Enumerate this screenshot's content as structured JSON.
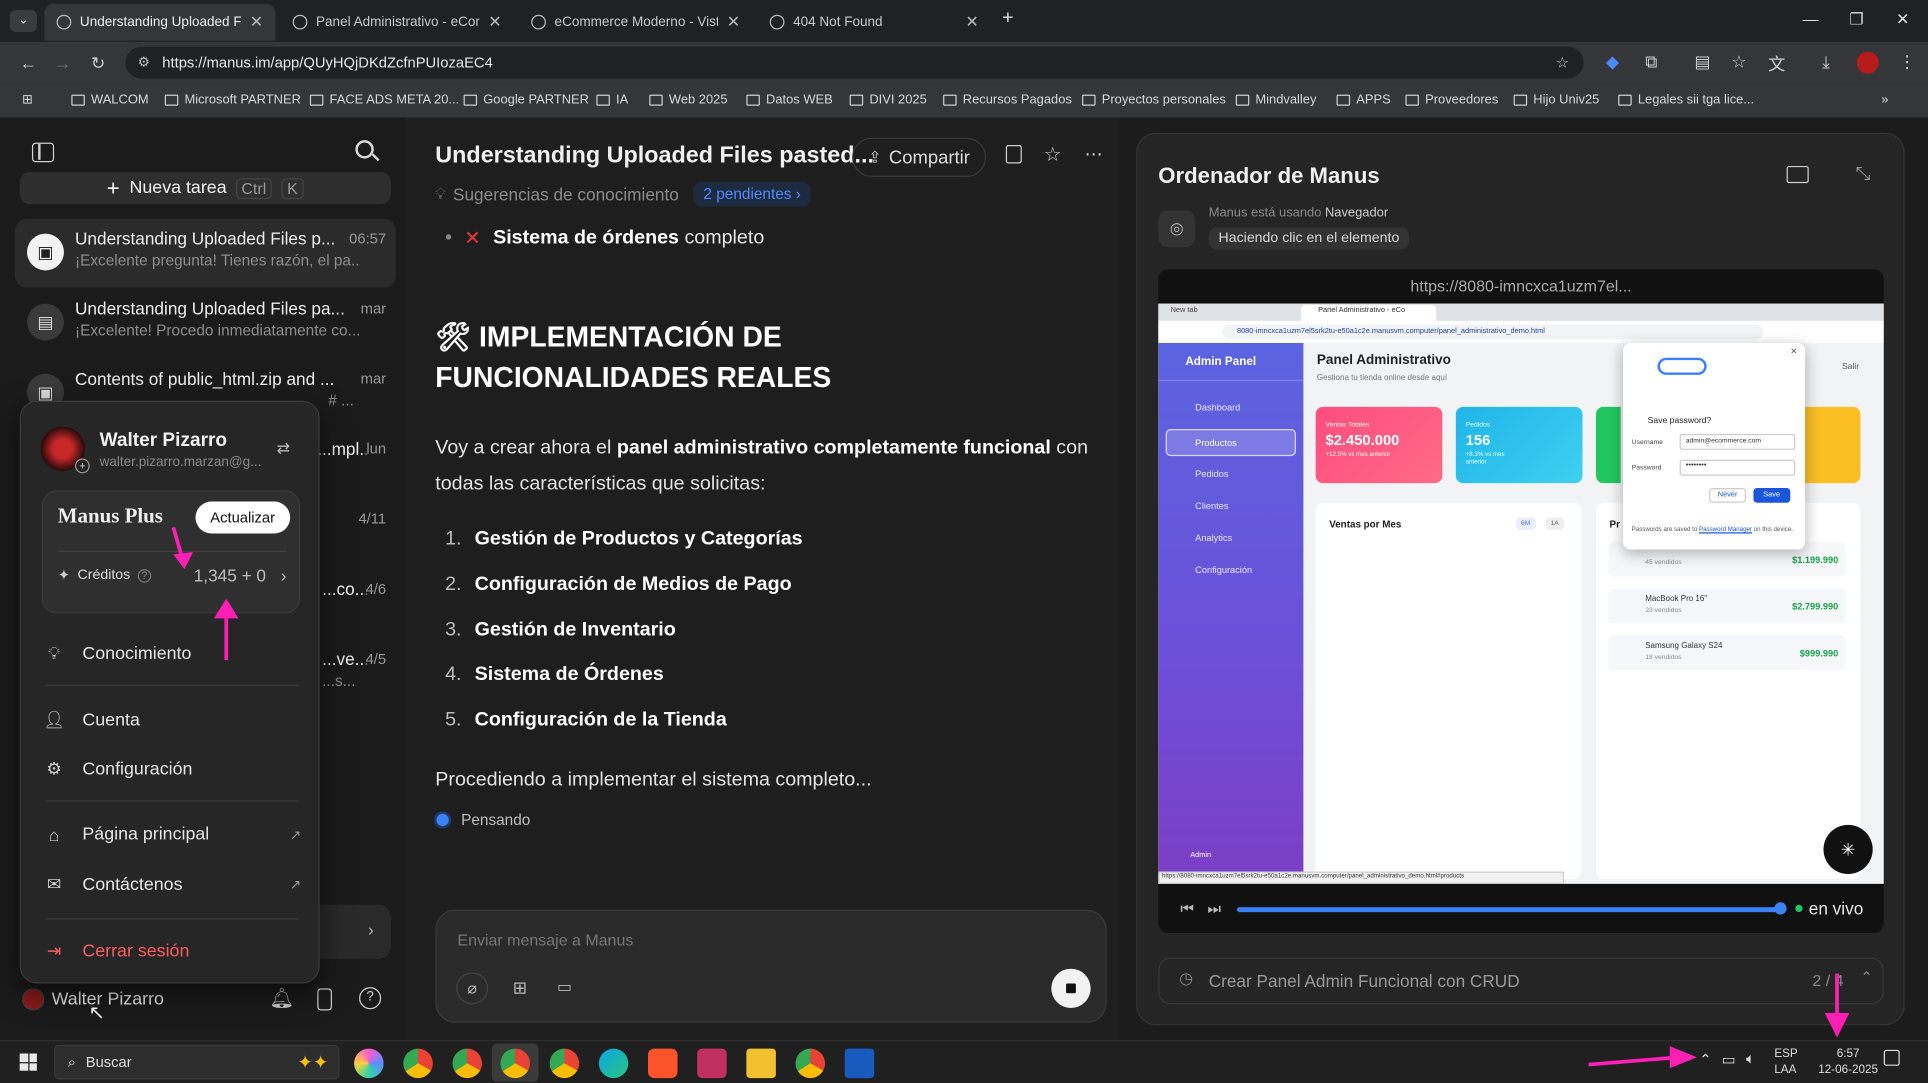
{
  "browser": {
    "tabs": [
      {
        "title": "Understanding Uploaded Files p"
      },
      {
        "title": "Panel Administrativo - eComm"
      },
      {
        "title": "eCommerce Moderno - Vista P"
      },
      {
        "title": "404 Not Found"
      }
    ],
    "new_tab": "+",
    "url": "https://manus.im/app/QUyHQjDKdZcfnPUIozaEC4",
    "bookmarks": [
      "WALCOM",
      "Microsoft PARTNER",
      "FACE ADS META 20...",
      "Google PARTNER",
      "IA",
      "Web 2025",
      "Datos WEB",
      "DIVI 2025",
      "Recursos Pagados",
      "Proyectos personales",
      "Mindvalley",
      "APPS",
      "Proveedores",
      "Hijo Univ25",
      "Legales sii tga lice..."
    ]
  },
  "sidebar": {
    "new_task": "Nueva tarea",
    "shortcut_keys": [
      "Ctrl",
      "K"
    ],
    "tasks": [
      {
        "title": "Understanding Uploaded Files p...",
        "snippet": "¡Excelente pregunta! Tienes razón, el pa...",
        "date": "06:57"
      },
      {
        "title": "Understanding Uploaded Files pa...",
        "snippet": "¡Excelente! Procedo inmediatamente co...",
        "date": "mar"
      },
      {
        "title": "Contents of public_html.zip and ...",
        "snippet": "# ...",
        "date": "mar"
      },
      {
        "title": "...mpl...",
        "snippet": "",
        "date": "lun"
      },
      {
        "title": "",
        "snippet": "",
        "date": "4/11"
      },
      {
        "title": "...co...",
        "snippet": "",
        "date": "4/6"
      },
      {
        "title": "...ve...",
        "snippet": "...s...",
        "date": "4/5"
      }
    ],
    "user_name": "Walter Pizarro"
  },
  "menu": {
    "user_name": "Walter Pizarro",
    "email": "walter.pizarro.marzan@g...",
    "plan": "Manus Plus",
    "upgrade": "Actualizar",
    "credits_label": "Créditos",
    "credits_value": "1,345 + 0",
    "items": [
      "Conocimiento",
      "Cuenta",
      "Configuración",
      "Página principal",
      "Contáctenos"
    ],
    "logout": "Cerrar sesión"
  },
  "chat": {
    "title": "Understanding Uploaded Files pasted...",
    "share": "Compartir",
    "knowledge": "Sugerencias de conocimiento",
    "pending": "2 pendientes",
    "bullet_bold": "Sistema de órdenes",
    "bullet_rest": "completo",
    "heading_line1": "IMPLEMENTACIÓN DE",
    "heading_line2": "FUNCIONALIDADES REALES",
    "para_a": "Voy a crear ahora el ",
    "para_b": "panel administrativo completamente funcional",
    "para_c": " con",
    "para_d": "todas las características que solicitas:",
    "list": [
      "Gestión de Productos y Categorías",
      "Configuración de Medios de Pago",
      "Gestión de Inventario",
      "Sistema de Órdenes",
      "Configuración de la Tienda"
    ],
    "proceeding": "Procediendo a implementar el sistema completo...",
    "thinking": "Pensando",
    "input_placeholder": "Enviar mensaje a Manus"
  },
  "computer": {
    "title": "Ordenador de Manus",
    "using_a": "Manus está usando ",
    "using_b": "Navegador",
    "action": "Haciendo clic en el elemento",
    "url": "https://8080-imncxca1uzm7el...",
    "live": "en vivo",
    "task": "Crear Panel Admin Funcional con CRUD",
    "progress": "2 / 4",
    "playback_fraction": 0.99
  },
  "screen": {
    "tabs": [
      "New tab",
      "Panel Administrativo - eCo"
    ],
    "url": "8080-imncxca1uzm7el5srk2tu-e50a1c2e.manusvm.computer/panel_administrativo_demo.html",
    "brand": "Admin Panel",
    "nav": [
      "Dashboard",
      "Productos",
      "Pedidos",
      "Clientes",
      "Analytics",
      "Configuración"
    ],
    "page_title": "Panel Administrativo",
    "page_sub": "Gestiona tu tienda online desde aquí",
    "exit": "Salir",
    "cards": [
      {
        "label": "Ventas Totales",
        "value": "$2.450.000",
        "sub": "+12.5% vs mes anterior"
      },
      {
        "label": "Pedidos",
        "value": "156",
        "sub": "+8.3% vs mes anterior"
      }
    ],
    "chart_title": "Ventas por Mes",
    "chart_btns": [
      "6M",
      "1A"
    ],
    "products_head": "Pr",
    "products": [
      {
        "name": "",
        "sold": "45 vendidos",
        "price": "$1.199.990"
      },
      {
        "name": "MacBook Pro 16\"",
        "sold": "23 vendidos",
        "price": "$2.799.990"
      },
      {
        "name": "Samsung Galaxy S24",
        "sold": "18 vendidos",
        "price": "$999.990"
      }
    ],
    "save_pw_title": "Save password?",
    "username_label": "Username",
    "username_value": "admin@ecommerce.com",
    "password_label": "Password",
    "password_value": "••••••••",
    "never": "Never",
    "save": "Save",
    "pw_note_a": "Passwords are saved to ",
    "pw_note_link": "Password Manager",
    "pw_note_b": "on this device.",
    "admin_label": "Admin",
    "status_url": "https://8080-imncxca1uzm7el5srk2tu-e50a1c2e.manusvm.computer/panel_administrativo_demo.html#products"
  },
  "taskbar": {
    "search": "Buscar",
    "lang1": "ESP",
    "lang2": "LAA",
    "time": "6:57",
    "date": "12-06-2025"
  },
  "colors": {
    "accent": "#3b82f6",
    "annotation": "#ff1fb4",
    "sidebar_purple": "#6d4fd8"
  }
}
